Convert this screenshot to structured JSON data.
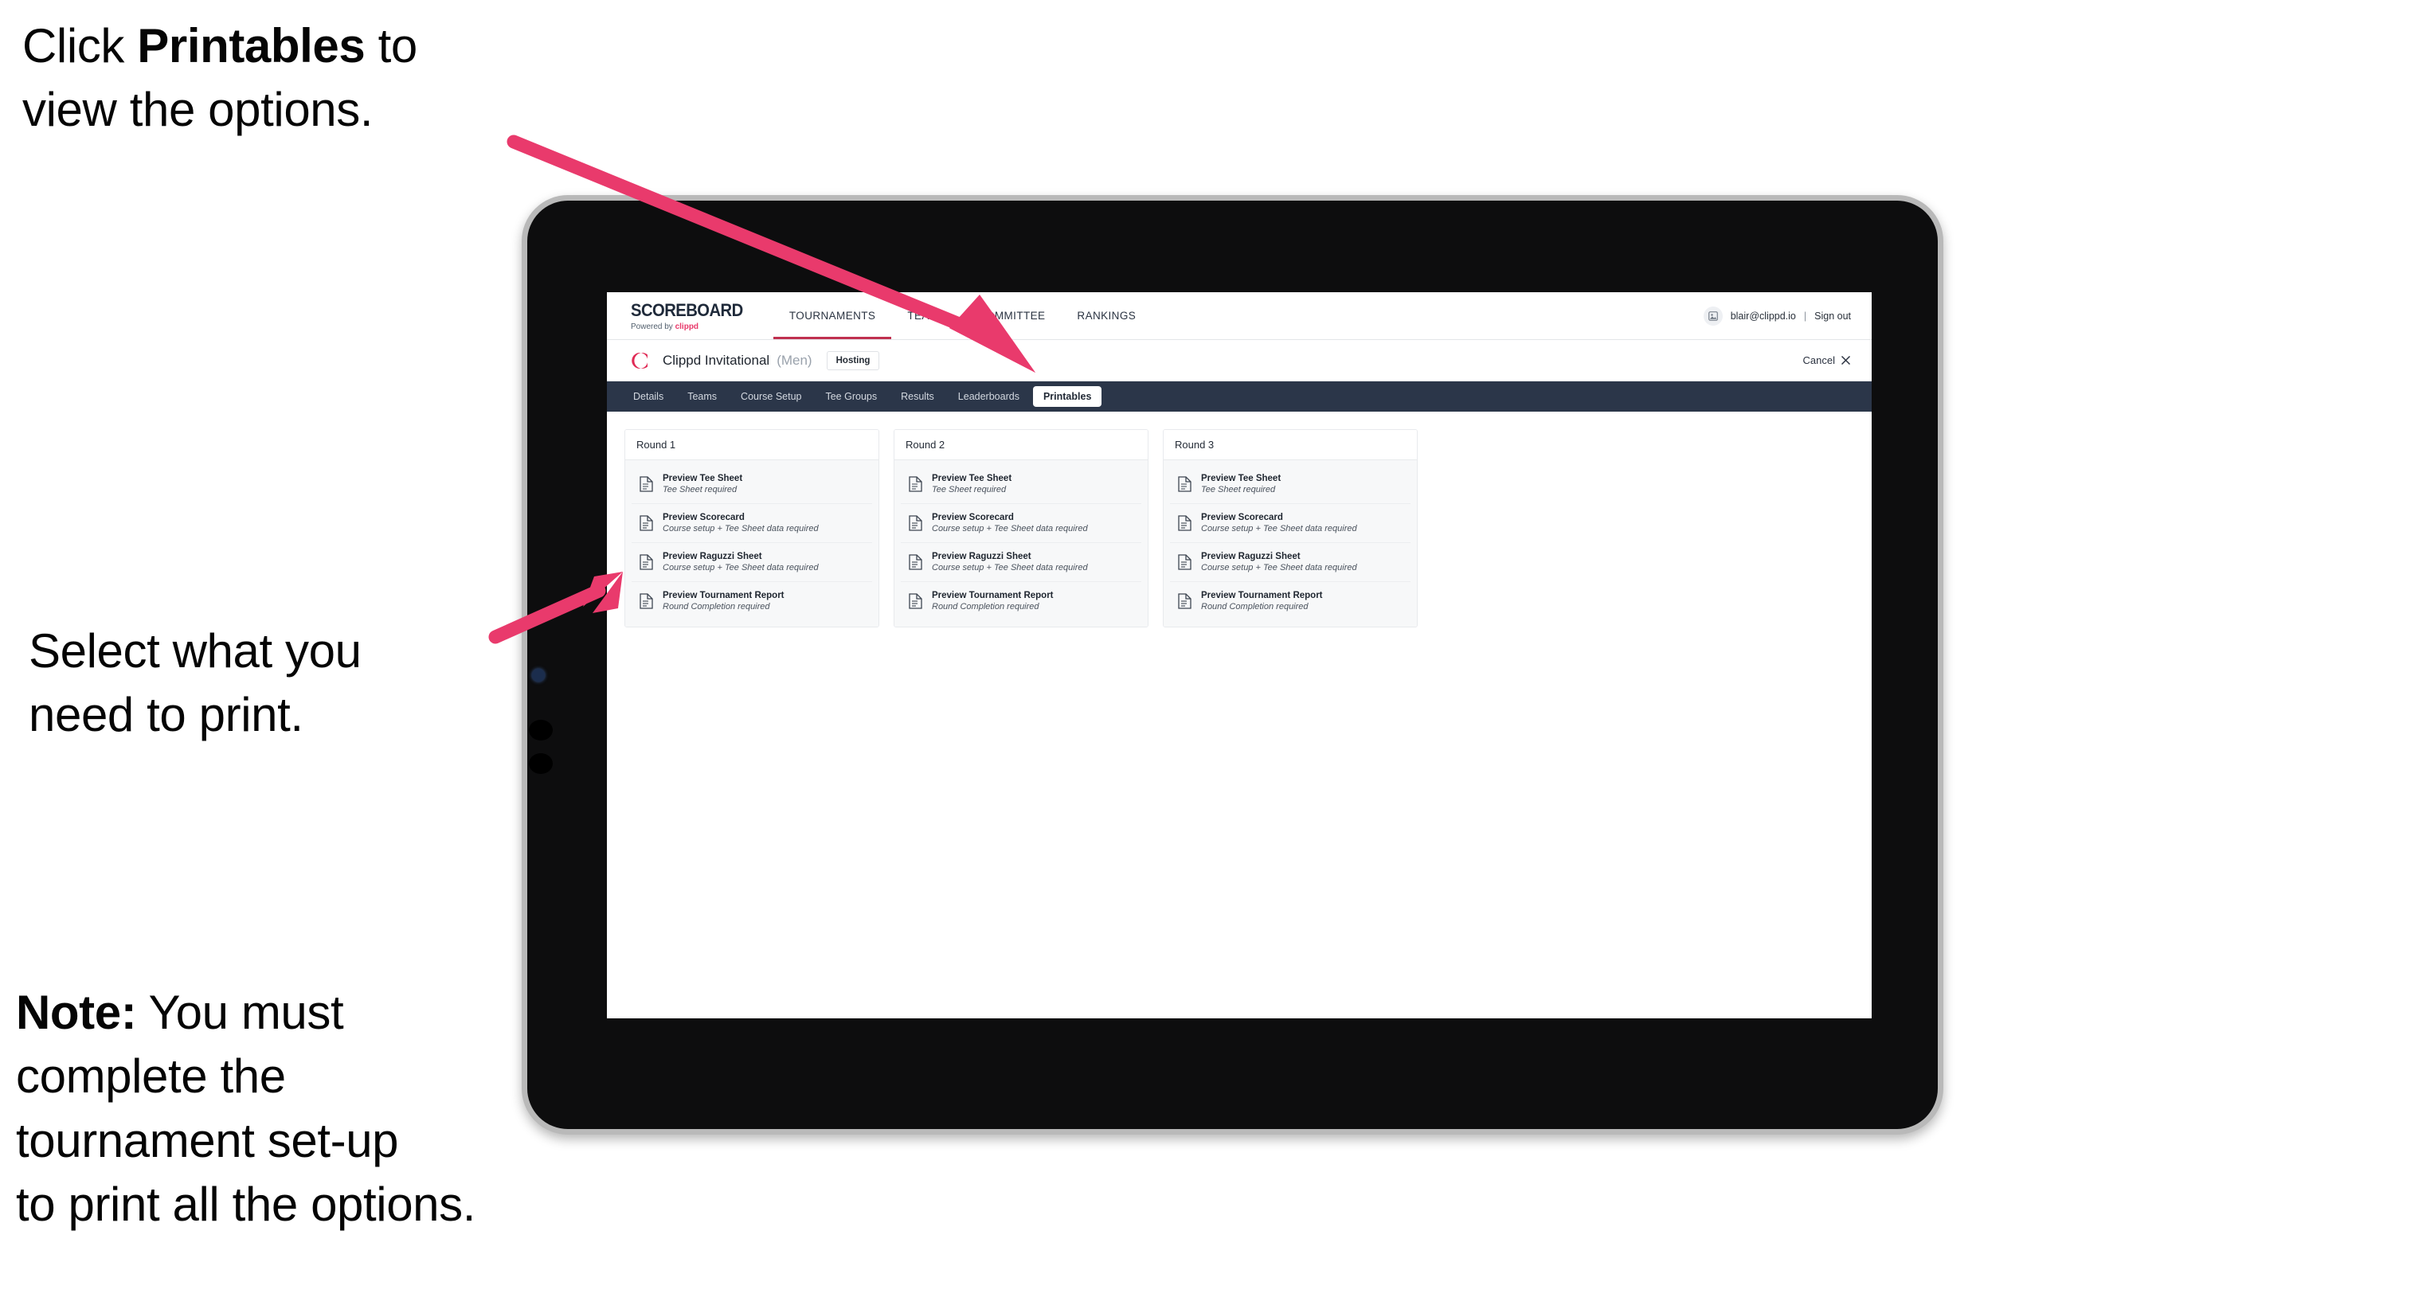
{
  "annotations": {
    "click_printables": {
      "pre": "Click ",
      "bold": "Printables",
      "post": " to\nview the options."
    },
    "select_print": {
      "text": "Select what you\n need to print."
    },
    "note": {
      "bold": "Note:",
      "post": " You must\ncomplete the\ntournament set-up\nto print all the options."
    }
  },
  "colors": {
    "arrow_pink": "#e93a6c",
    "nav_navy": "#2b3649",
    "brand_red": "#e8386a",
    "accent_underline": "#c0304f"
  },
  "app": {
    "brand": {
      "title": "SCOREBOARD",
      "powered_prefix": "Powered by ",
      "powered_name": "clippd"
    },
    "main_nav": [
      {
        "label": "TOURNAMENTS",
        "active": true
      },
      {
        "label": "TEAMS",
        "active": false
      },
      {
        "label": "COMMITTEE",
        "active": false
      },
      {
        "label": "RANKINGS",
        "active": false
      }
    ],
    "user": {
      "email": "blair@clippd.io",
      "separator": "|",
      "sign_out": "Sign out",
      "avatar_icon": "user-avatar-icon"
    },
    "tournament": {
      "logo_letter": "C",
      "name": "Clippd Invitational",
      "gender": "(Men)",
      "badge": "Hosting",
      "cancel_label": "Cancel",
      "cancel_icon": "close-icon"
    },
    "sub_nav": [
      {
        "label": "Details",
        "active": false
      },
      {
        "label": "Teams",
        "active": false
      },
      {
        "label": "Course Setup",
        "active": false
      },
      {
        "label": "Tee Groups",
        "active": false
      },
      {
        "label": "Results",
        "active": false
      },
      {
        "label": "Leaderboards",
        "active": false
      },
      {
        "label": "Printables",
        "active": true
      }
    ],
    "rounds": [
      {
        "title": "Round 1",
        "items": [
          {
            "title": "Preview Tee Sheet",
            "sub": "Tee Sheet required",
            "icon": "document-icon"
          },
          {
            "title": "Preview Scorecard",
            "sub": "Course setup + Tee Sheet data required",
            "icon": "document-icon"
          },
          {
            "title": "Preview Raguzzi Sheet",
            "sub": "Course setup + Tee Sheet data required",
            "icon": "document-icon"
          },
          {
            "title": "Preview Tournament Report",
            "sub": "Round Completion required",
            "icon": "document-icon"
          }
        ]
      },
      {
        "title": "Round 2",
        "items": [
          {
            "title": "Preview Tee Sheet",
            "sub": "Tee Sheet required",
            "icon": "document-icon"
          },
          {
            "title": "Preview Scorecard",
            "sub": "Course setup + Tee Sheet data required",
            "icon": "document-icon"
          },
          {
            "title": "Preview Raguzzi Sheet",
            "sub": "Course setup + Tee Sheet data required",
            "icon": "document-icon"
          },
          {
            "title": "Preview Tournament Report",
            "sub": "Round Completion required",
            "icon": "document-icon"
          }
        ]
      },
      {
        "title": "Round 3",
        "items": [
          {
            "title": "Preview Tee Sheet",
            "sub": "Tee Sheet required",
            "icon": "document-icon"
          },
          {
            "title": "Preview Scorecard",
            "sub": "Course setup + Tee Sheet data required",
            "icon": "document-icon"
          },
          {
            "title": "Preview Raguzzi Sheet",
            "sub": "Course setup + Tee Sheet data required",
            "icon": "document-icon"
          },
          {
            "title": "Preview Tournament Report",
            "sub": "Round Completion required",
            "icon": "document-icon"
          }
        ]
      }
    ]
  }
}
